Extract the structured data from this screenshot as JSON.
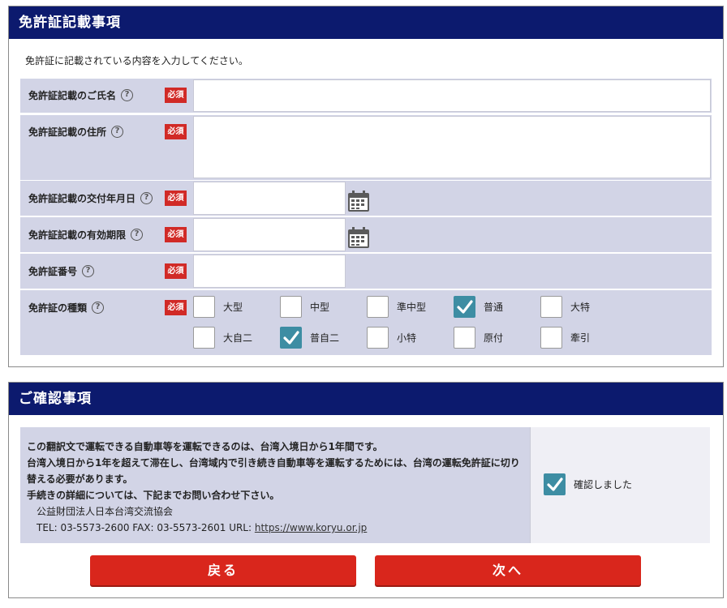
{
  "license": {
    "title": "免許証記載事項",
    "intro": "免許証に記載されている内容を入力してください。",
    "required_label": "必須",
    "help_glyph": "?",
    "fields": {
      "name": {
        "label": "免許証記載のご氏名",
        "value": ""
      },
      "address": {
        "label": "免許証記載の住所",
        "value": ""
      },
      "issue_date": {
        "label": "免許証記載の交付年月日",
        "value": ""
      },
      "expiry_date": {
        "label": "免許証記載の有効期限",
        "value": ""
      },
      "number": {
        "label": "免許証番号",
        "value": ""
      }
    },
    "types": {
      "label": "免許証の種類",
      "options": [
        {
          "label": "大型",
          "checked": false
        },
        {
          "label": "中型",
          "checked": false
        },
        {
          "label": "準中型",
          "checked": false
        },
        {
          "label": "普通",
          "checked": true
        },
        {
          "label": "大特",
          "checked": false
        },
        {
          "label": "大自二",
          "checked": false
        },
        {
          "label": "普自二",
          "checked": true
        },
        {
          "label": "小特",
          "checked": false
        },
        {
          "label": "原付",
          "checked": false
        },
        {
          "label": "牽引",
          "checked": false
        }
      ]
    }
  },
  "confirm": {
    "title": "ご確認事項",
    "line1": "この翻訳文で運転できる自動車等を運転できるのは、台湾入境日から1年間です。",
    "line2": "台湾入境日から1年を超えて滞在し、台湾域内で引き続き自動車等を運転するためには、台湾の運転免許証に切り替える必要があります。",
    "line3": "手続きの詳細については、下記までお問い合わせ下さい。",
    "org": "公益財団法人日本台湾交流協会",
    "contact_prefix": "TEL: 03-5573-2600 FAX: 03-5573-2601 URL: ",
    "url": "https://www.koryu.or.jp",
    "checkbox_label": "確認しました",
    "checked": true
  },
  "buttons": {
    "back": "戻る",
    "next": "次へ"
  },
  "colors": {
    "header": "#0c1a6e",
    "row_bg": "#d2d4e6",
    "required": "#d12a26",
    "check": "#3d8da3",
    "button": "#d9261c"
  }
}
